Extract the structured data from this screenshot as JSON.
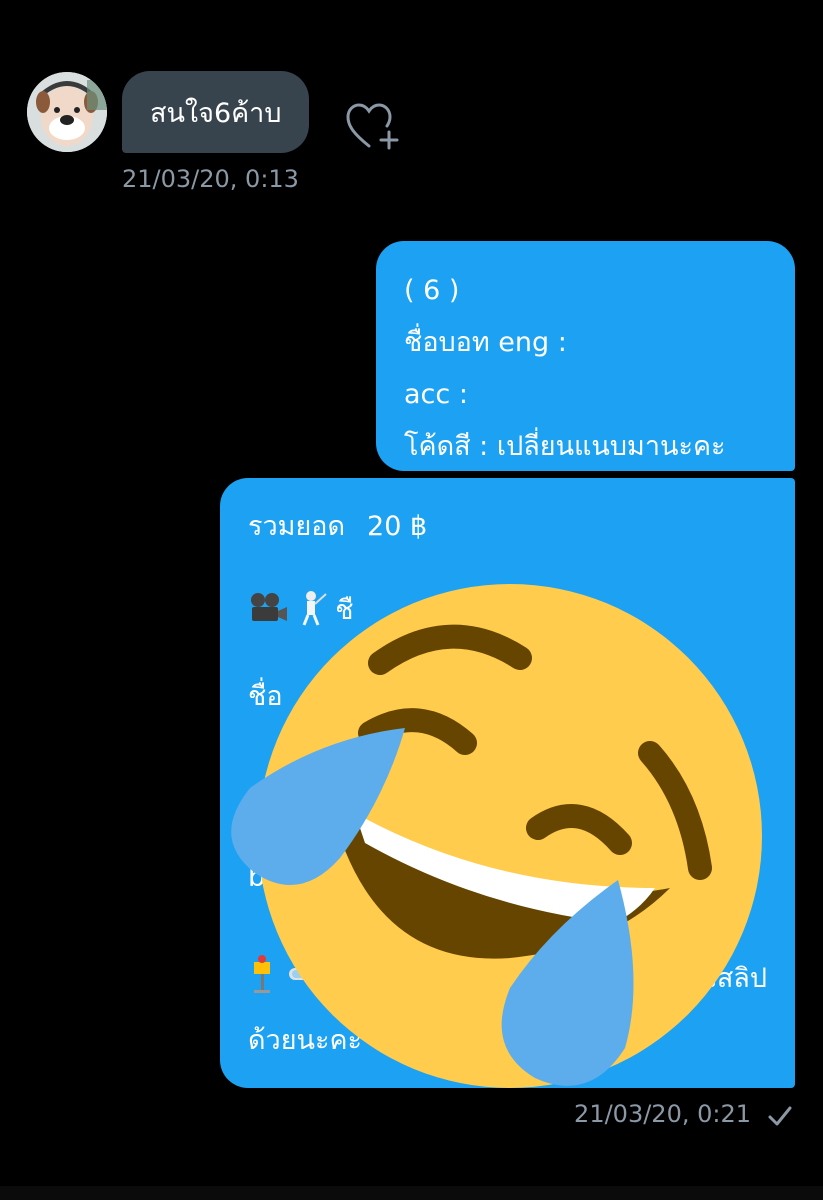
{
  "conversation": {
    "incoming": {
      "text": "สนใจ6ค้าบ",
      "timestamp": "21/03/20, 0:13"
    },
    "outgoing_1": {
      "lines": [
        "( 6 )",
        "ชื่อบอท eng :",
        "acc :",
        "โค้ดสี : เปลี่ยนแนบมานะคะ"
      ]
    },
    "outgoing_2": {
      "sum_label": "รวมยอด",
      "sum_value": "20 ฿",
      "line_ico1_text": "ชื",
      "line_name_partial": "ชื่อ",
      "line_bi_partial": "bi",
      "line_tail": "งสลิป",
      "line_end": "ด้วยนะคะ",
      "timestamp": "21/03/20, 0:21"
    }
  },
  "icons": {
    "like": "heart-plus-icon",
    "read_receipt": "checkmark-icon",
    "overlay": "face-with-tears-of-joy-emoji",
    "projector": "film-projector-emoji",
    "fencer": "fencer-emoji",
    "bus_stop": "bus-stop-emoji",
    "goggles": "goggles-emoji"
  },
  "colors": {
    "background": "#000000",
    "incoming_bubble": "#38444d",
    "outgoing_bubble": "#1da1f2",
    "timestamp": "#8b98a5",
    "emoji_face": "#ffcc4d",
    "emoji_tear": "#5dadec"
  }
}
